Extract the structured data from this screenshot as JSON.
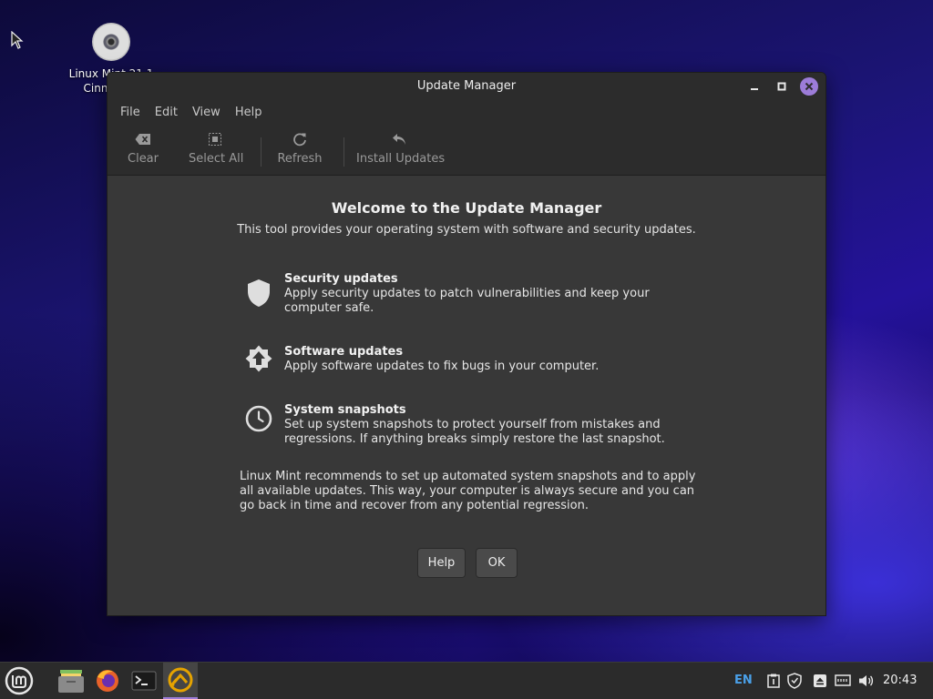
{
  "desktop": {
    "icon_label_line1": "Linux Mint 21.1",
    "icon_label_line2": "Cinnamon"
  },
  "window": {
    "title": "Update Manager",
    "menu": [
      "File",
      "Edit",
      "View",
      "Help"
    ],
    "toolbar": {
      "clear": "Clear",
      "select_all": "Select All",
      "refresh": "Refresh",
      "install": "Install Updates"
    },
    "welcome": {
      "title": "Welcome to the Update Manager",
      "subtitle": "This tool provides your operating system with software and security updates."
    },
    "features": [
      {
        "title": "Security updates",
        "description": "Apply security updates to patch vulnerabilities and keep your computer safe.",
        "icon": "shield-icon"
      },
      {
        "title": "Software updates",
        "description": "Apply software updates to fix bugs in your computer.",
        "icon": "upgrade-arrow-icon"
      },
      {
        "title": "System snapshots",
        "description": "Set up system snapshots to protect yourself from mistakes and regressions. If anything breaks simply restore the last snapshot.",
        "icon": "clock-icon"
      }
    ],
    "recommendation": "Linux Mint recommends to set up automated system snapshots and to apply all available updates. This way, your computer is always secure and you can go back in time and recover from any potential regression.",
    "buttons": {
      "help": "Help",
      "ok": "OK"
    }
  },
  "panel": {
    "language": "EN",
    "clock": "20:43",
    "accent_color": "#9c7cd8"
  }
}
